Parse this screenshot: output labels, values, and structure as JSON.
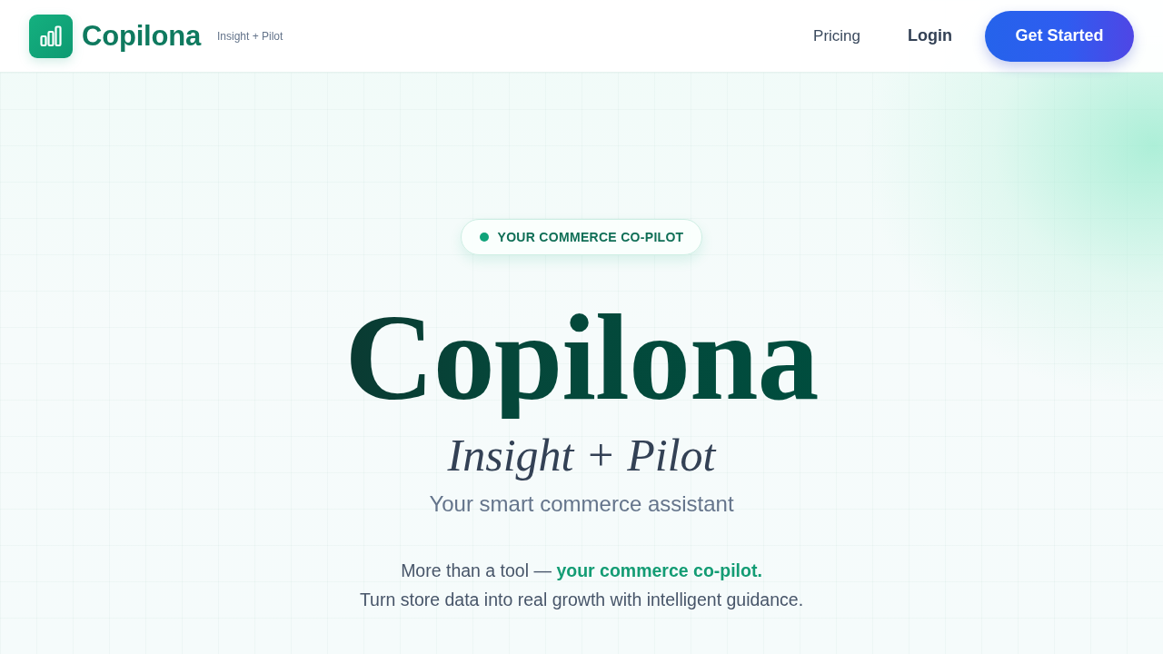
{
  "header": {
    "logo": {
      "name": "Copilona",
      "tagline": "Insight + Pilot"
    },
    "nav": [
      {
        "label": "Pricing",
        "kind": "link"
      },
      {
        "label": "Login",
        "kind": "login"
      }
    ],
    "cta": "Get Started"
  },
  "hero": {
    "badge": "YOUR COMMERCE CO-PILOT",
    "title": "Copilona",
    "subtitle": "Insight + Pilot",
    "tagline": "Your smart commerce assistant",
    "intro": [
      "More than a tool — **your commerce co-pilot.**",
      "Turn store data into real growth with intelligent guidance."
    ]
  }
}
